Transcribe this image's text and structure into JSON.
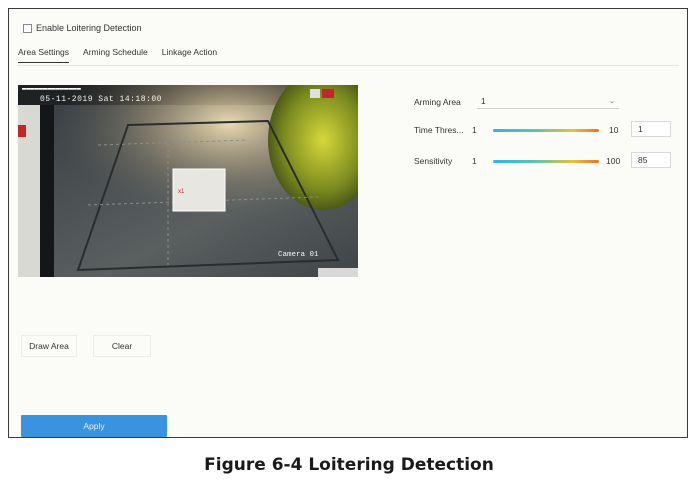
{
  "enable": {
    "label": "Enable Loitering Detection",
    "checked": false
  },
  "tabs": [
    {
      "label": "Area Settings",
      "active": true
    },
    {
      "label": "Arming Schedule",
      "active": false
    },
    {
      "label": "Linkage Action",
      "active": false
    }
  ],
  "video": {
    "timestamp": "05-11-2019 Sat 14:18:00",
    "camera_name": "Camera 01"
  },
  "settings": {
    "arming_area": {
      "label": "Arming Area",
      "value": "1"
    },
    "time_threshold": {
      "label": "Time Thres...",
      "min": "1",
      "max": "10",
      "value": "1",
      "level": 0.0
    },
    "sensitivity": {
      "label": "Sensitivity",
      "min": "1",
      "max": "100",
      "value": "85",
      "level": 0.85
    }
  },
  "buttons": {
    "draw_area": "Draw Area",
    "clear": "Clear",
    "apply": "Apply"
  },
  "caption": "Figure 6-4 Loitering Detection",
  "colors": {
    "apply_bg": "#3a93e0",
    "slider_gradient": [
      "#2fb4e8",
      "#e6c23a",
      "#e8742a"
    ]
  }
}
